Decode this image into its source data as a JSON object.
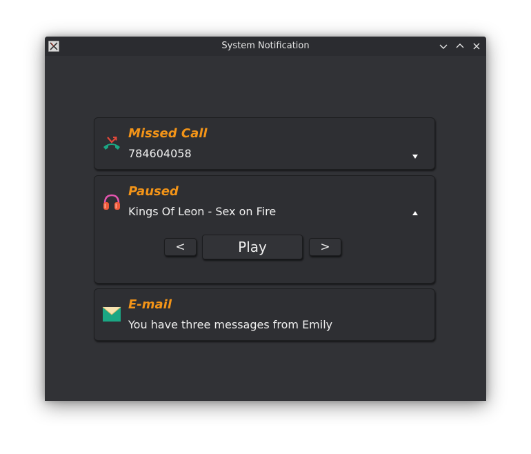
{
  "window": {
    "title": "System Notification"
  },
  "notifications": [
    {
      "title": "Missed Call",
      "text": "784604058",
      "icon": "missed-call-icon",
      "toggle": "expand"
    },
    {
      "title": "Paused",
      "text": "Kings Of Leon - Sex on Fire",
      "icon": "headphones-icon",
      "toggle": "collapse",
      "controls": {
        "prev_label": "<",
        "play_label": "Play",
        "next_label": ">"
      }
    },
    {
      "title": "E-mail",
      "text": "You have three messages from Emily",
      "icon": "envelope-icon"
    }
  ],
  "colors": {
    "accent": "#f39418",
    "background": "#313236",
    "card": "#2e2f33",
    "text": "#f0f0f0"
  }
}
